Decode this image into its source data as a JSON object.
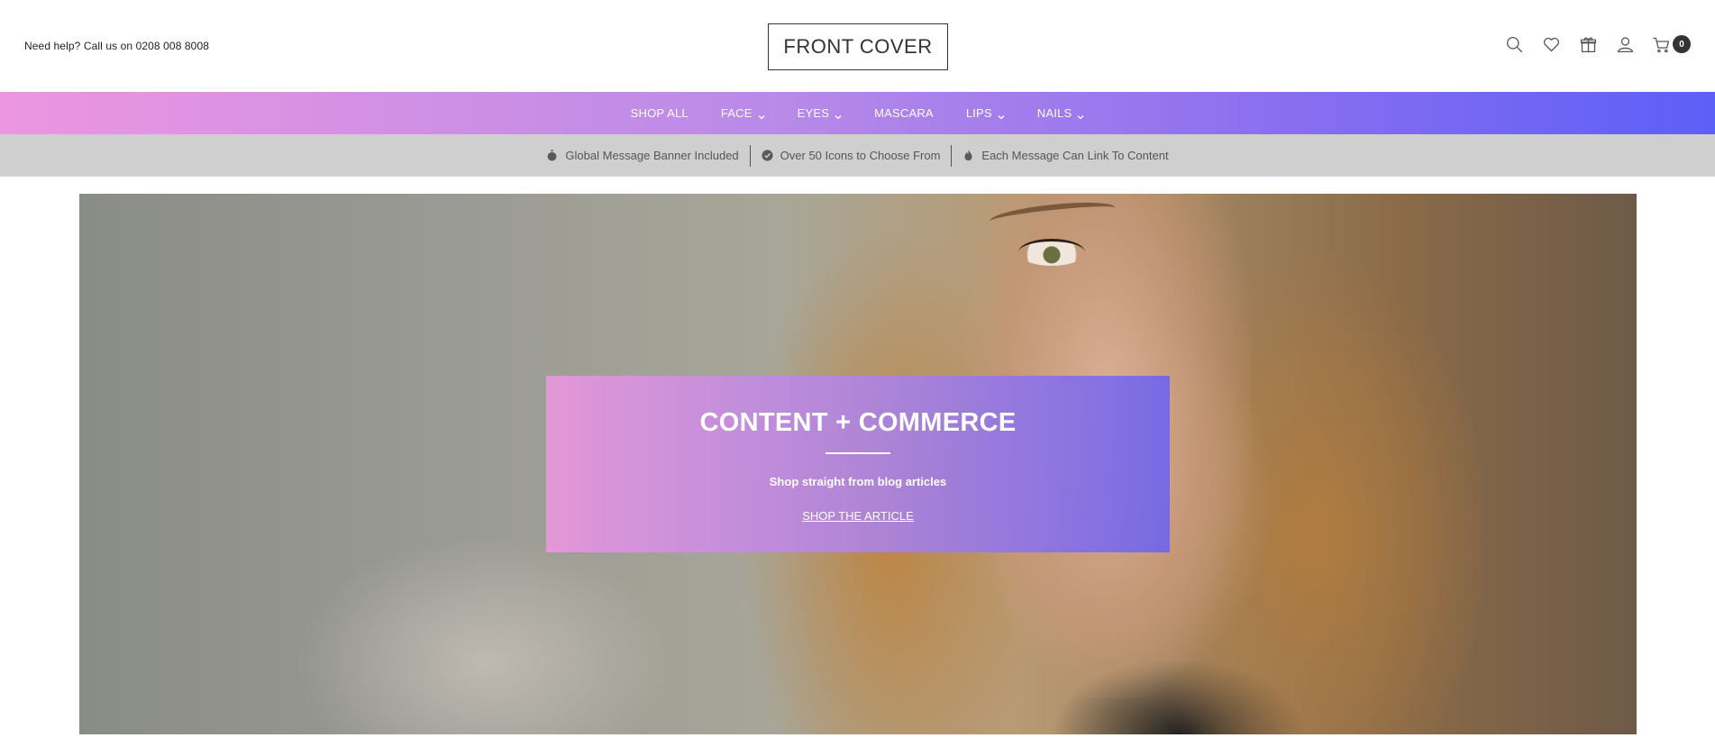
{
  "header": {
    "help_text": "Need help? Call us on 0208 008 8008",
    "logo": "FRONT COVER",
    "icons": [
      "search-icon",
      "heart-icon",
      "gift-icon",
      "user-icon",
      "cart-icon"
    ],
    "cart_count": "0"
  },
  "nav": {
    "items": [
      {
        "label": "SHOP ALL",
        "has_dropdown": false
      },
      {
        "label": "FACE",
        "has_dropdown": true
      },
      {
        "label": "EYES",
        "has_dropdown": true
      },
      {
        "label": "MASCARA",
        "has_dropdown": false
      },
      {
        "label": "LIPS",
        "has_dropdown": true
      },
      {
        "label": "NAILS",
        "has_dropdown": true
      }
    ],
    "gradient": [
      "#ec96e0",
      "#5c5ff8"
    ]
  },
  "messages": [
    {
      "icon": "stopwatch-icon",
      "text": "Global Message Banner Included"
    },
    {
      "icon": "check-circle-icon",
      "text": "Over 50 Icons to Choose From"
    },
    {
      "icon": "flame-icon",
      "text": "Each Message Can Link To Content"
    }
  ],
  "hero": {
    "title": "CONTENT + COMMERCE",
    "subtitle": "Shop straight from blog articles",
    "link": "SHOP THE ARTICLE"
  }
}
